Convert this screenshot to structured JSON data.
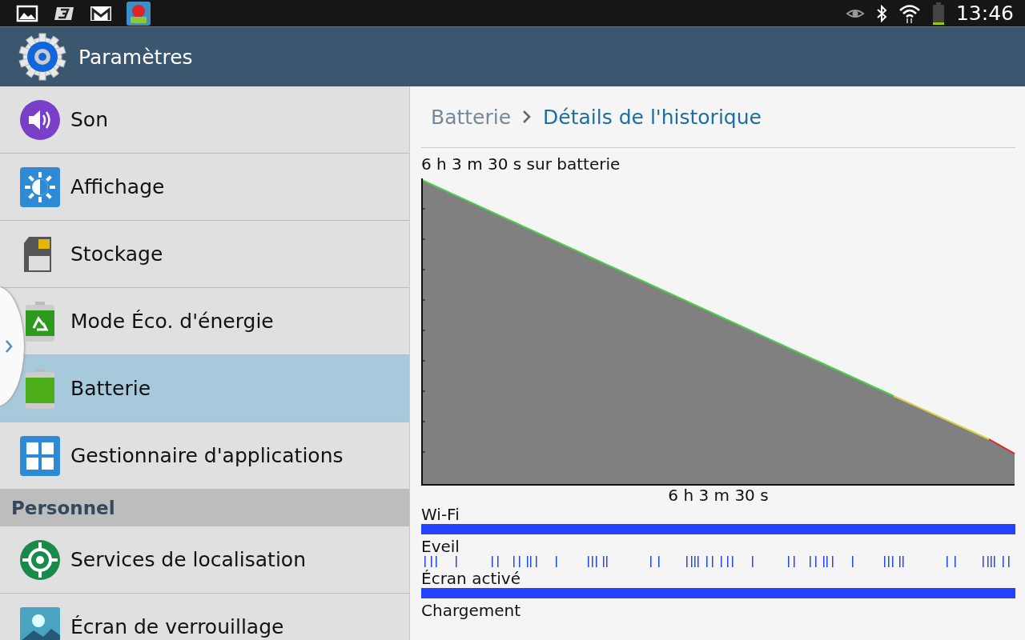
{
  "status_bar": {
    "time": "13:46"
  },
  "header": {
    "title": "Paramètres"
  },
  "sidebar": {
    "items": [
      {
        "label": "Son",
        "selected": false
      },
      {
        "label": "Affichage",
        "selected": false
      },
      {
        "label": "Stockage",
        "selected": false
      },
      {
        "label": "Mode Éco. d'énergie",
        "selected": false
      },
      {
        "label": "Batterie",
        "selected": true
      },
      {
        "label": "Gestionnaire d'applications",
        "selected": false
      }
    ],
    "section": "Personnel",
    "section_items": [
      {
        "label": "Services de localisation",
        "selected": false
      },
      {
        "label": "Écran de verrouillage",
        "selected": false
      }
    ]
  },
  "breadcrumb": {
    "parent": "Batterie",
    "current": "Détails de l'historique"
  },
  "history": {
    "duration": "6 h 3 m 30 s sur batterie",
    "axis_label": "6 h 3 m 30 s",
    "tracks": [
      {
        "label": "Wi-Fi",
        "kind": "solid"
      },
      {
        "label": "Eveil",
        "kind": "ticks"
      },
      {
        "label": "Écran activé",
        "kind": "solid"
      },
      {
        "label": "Chargement",
        "kind": "none"
      }
    ]
  }
}
